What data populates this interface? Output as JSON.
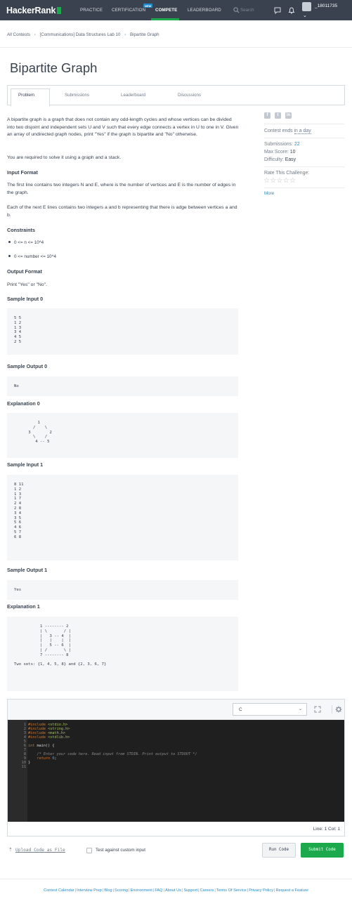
{
  "nav": {
    "logo": "HackerRank",
    "links": [
      "PRACTICE",
      "CERTIFICATION",
      "COMPETE",
      "LEADERBOARD"
    ],
    "new_badge": "NEW",
    "search_placeholder": "Search",
    "username": "_18011735"
  },
  "breadcrumb": [
    "All Contests",
    "[Communications] Data Structures Lab 10",
    "Bipartite Graph"
  ],
  "page_title": "Bipartite Graph",
  "tabs": [
    "Problem",
    "Submissions",
    "Leaderboard",
    "Discussions"
  ],
  "problem": {
    "intro_1": "A bipartite graph is a graph that does not contain any odd-length cycles and whose vertices can be divided into two disjoint and independent sets U and V such that every edge connects a vertex in U to one in V. Given an array of undirected graph nodes, print \"Yes\" if the graph is bipartite and \"No\" otherwise.",
    "intro_2": "You are required to solve it using a graph and a stack.",
    "h_input": "Input Format",
    "input_1": "The first line contains two integers N and E, where is the number of vertices and E is the number of edges in the graph.",
    "input_2": "Each of the next E lines contains two integers a and b representing that there is adge between vertices a and b.",
    "h_constraints": "Constraints",
    "constraints": [
      "0 <= n <= 10^4",
      "0 <= number <= 10^4"
    ],
    "h_output": "Output Format",
    "output": "Print \"Yes\" or \"No\".",
    "h_sample_in_0": "Sample Input 0",
    "sample_in_0": "5 5\n1 2\n1 3\n3 4\n4 5\n2 5",
    "h_sample_out_0": "Sample Output 0",
    "sample_out_0": "No",
    "h_expl_0": "Explanation 0",
    "expl_0": "          1\n        /    \\\n      3        2\n        \\    /\n         4 -- 5",
    "h_sample_in_1": "Sample Input 1",
    "sample_in_1": "8 11\n1 2\n1 3\n1 7\n2 4\n2 8\n3 4\n3 5\n5 6\n4 6\n5 7\n6 8",
    "h_sample_out_1": "Sample Output 1",
    "sample_out_1": "Yes",
    "h_expl_1": "Explanation 1",
    "expl_1": "           1 -------- 2\n           | \\       / |\n           |   3 -- 4  |\n           |   |    |  |\n           |   5 -- 6  |\n           | /       \\ |\n           7 -------- 8\n\nTwo sets: {1, 4, 5, 8} and {2, 3, 6, 7}"
  },
  "sidebar": {
    "social_icons": [
      "facebook-icon",
      "twitter-icon",
      "linkedin-icon"
    ],
    "contest_ends_label": "Contest ends",
    "contest_ends_value": "in a day",
    "submissions_label": "Submissions:",
    "submissions_value": "22",
    "max_score_label": "Max Score:",
    "max_score_value": "10",
    "difficulty_label": "Difficulty:",
    "difficulty_value": "Easy",
    "rate_label": "Rate This Challenge:",
    "stars": "☆☆☆☆☆",
    "more": "More"
  },
  "editor": {
    "language": "C",
    "line_numbers": "1\n2\n3\n4\n5\n6\n7\n8\n9\n10\n11",
    "status": "Line: 1 Col: 1"
  },
  "actions": {
    "upload": "Upload Code as File",
    "custom_input": "Test against custom input",
    "run": "Run Code",
    "submit": "Submit Code"
  },
  "footer": [
    "Contest Calendar",
    "Interview Prep",
    "Blog",
    "Scoring",
    "Environment",
    "FAQ",
    "About Us",
    "Support",
    "Careers",
    "Terms Of Service",
    "Privacy Policy",
    "Request a Feature"
  ],
  "colors": {
    "nav_bg": "#39424e",
    "brand_green": "#1ba94c",
    "link_blue": "#1f8acb",
    "editor_bg": "#1f1f1f"
  }
}
